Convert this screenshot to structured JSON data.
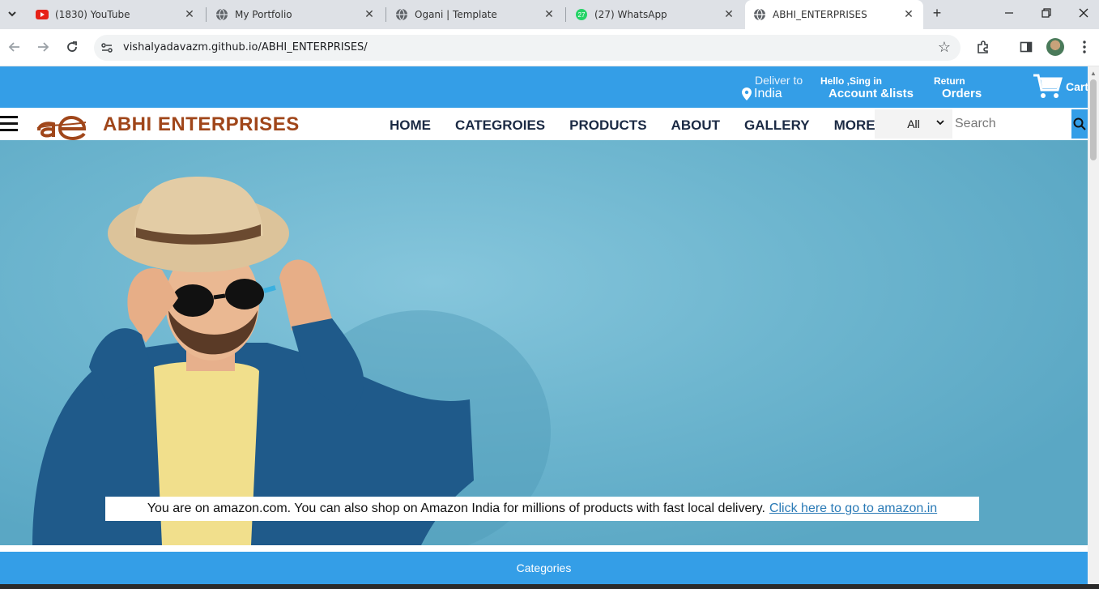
{
  "browser": {
    "tabs": [
      {
        "title": "(1830) YouTube",
        "icon": "youtube-icon"
      },
      {
        "title": "My Portfolio",
        "icon": "globe-icon"
      },
      {
        "title": "Ogani | Template",
        "icon": "globe-icon"
      },
      {
        "title": "(27) WhatsApp",
        "icon": "whatsapp-icon",
        "badge": "27"
      },
      {
        "title": "ABHI_ENTERPRISES",
        "icon": "globe-icon",
        "active": true
      }
    ],
    "url": "vishalyadavazm.github.io/ABHI_ENTERPRISES/"
  },
  "topbar": {
    "deliver_small": "Deliver to",
    "deliver_big": "India",
    "account_small": "Hello ,Sing in",
    "account_big": "Account &lists",
    "returns_small": "Return",
    "returns_big": "Orders",
    "cart_label": "Cart"
  },
  "navbar": {
    "brand": "ABHI ENTERPRISES",
    "menu": [
      "HOME",
      "CATEGROIES",
      "PRODUCTS",
      "ABOUT",
      "GALLERY",
      "MORE"
    ],
    "search_scope": "All",
    "search_placeholder": "Search"
  },
  "banner": {
    "text": "You are on amazon.com. You can also shop on Amazon India for millions of products with fast local delivery.",
    "link": "Click here to go to amazon.in"
  },
  "categories_label": "Categories",
  "colors": {
    "brand_blue": "#349ee7",
    "brand_text": "#a0461a",
    "nav_text": "#1b2a44"
  }
}
